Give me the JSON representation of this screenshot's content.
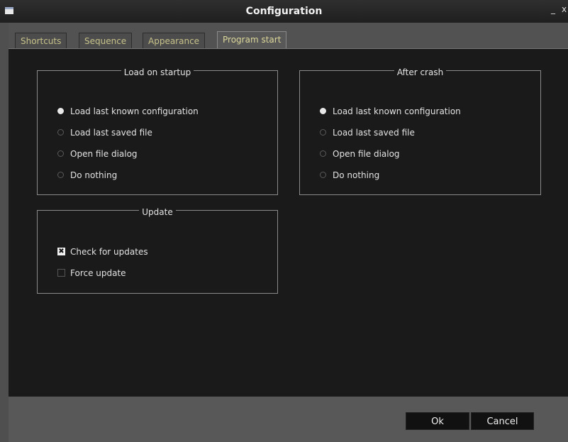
{
  "window": {
    "title": "Configuration",
    "minimize_glyph": "_",
    "close_glyph": "x"
  },
  "tabs": [
    "Shortcuts",
    "Sequence",
    "Appearance",
    "Program start"
  ],
  "active_tab": "Program start",
  "load_on_startup": {
    "title": "Load on startup",
    "options": [
      {
        "label": "Load last known configuration",
        "selected": true
      },
      {
        "label": "Load last saved file",
        "selected": false
      },
      {
        "label": "Open file dialog",
        "selected": false
      },
      {
        "label": "Do nothing",
        "selected": false
      }
    ]
  },
  "after_crash": {
    "title": "After crash",
    "options": [
      {
        "label": "Load last known configuration",
        "selected": true
      },
      {
        "label": "Load last saved file",
        "selected": false
      },
      {
        "label": "Open file dialog",
        "selected": false
      },
      {
        "label": "Do nothing",
        "selected": false
      }
    ]
  },
  "update": {
    "title": "Update",
    "options": [
      {
        "label": "Check for updates",
        "checked": true
      },
      {
        "label": "Force update",
        "checked": false
      }
    ]
  },
  "buttons": {
    "ok": "Ok",
    "cancel": "Cancel"
  },
  "check_mark": "✖"
}
